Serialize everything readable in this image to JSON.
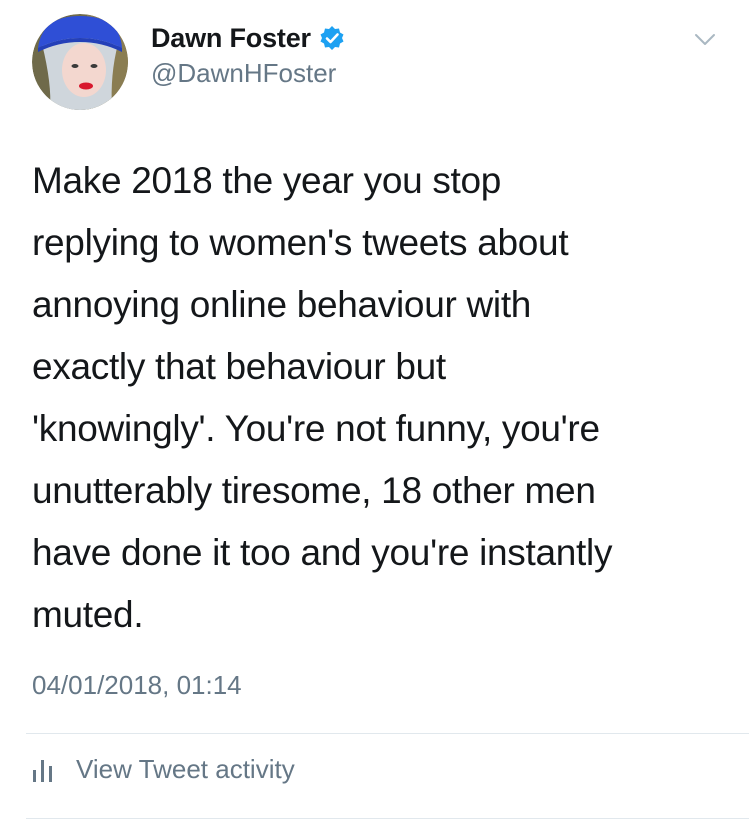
{
  "author": {
    "display_name": "Dawn Foster",
    "handle": "@DawnHFoster",
    "verified": true
  },
  "tweet": {
    "text": "Make 2018 the year you stop\nreplying to women's tweets about\nannoying online behaviour with\nexactly that behaviour but\n'knowingly'. You're not funny, you're\nunutterably tiresome, 18 other men\nhave done it too and you're instantly\nmuted.",
    "timestamp": "04/01/2018, 01:14"
  },
  "actions": {
    "activity_label": "View Tweet activity"
  },
  "icons": {
    "verified": "verified-badge-icon",
    "caret": "chevron-down-icon",
    "activity": "bar-chart-icon"
  },
  "colors": {
    "text": "#14171a",
    "secondary": "#657786",
    "verified_blue": "#1da1f2",
    "divider": "#e1e8ed"
  }
}
